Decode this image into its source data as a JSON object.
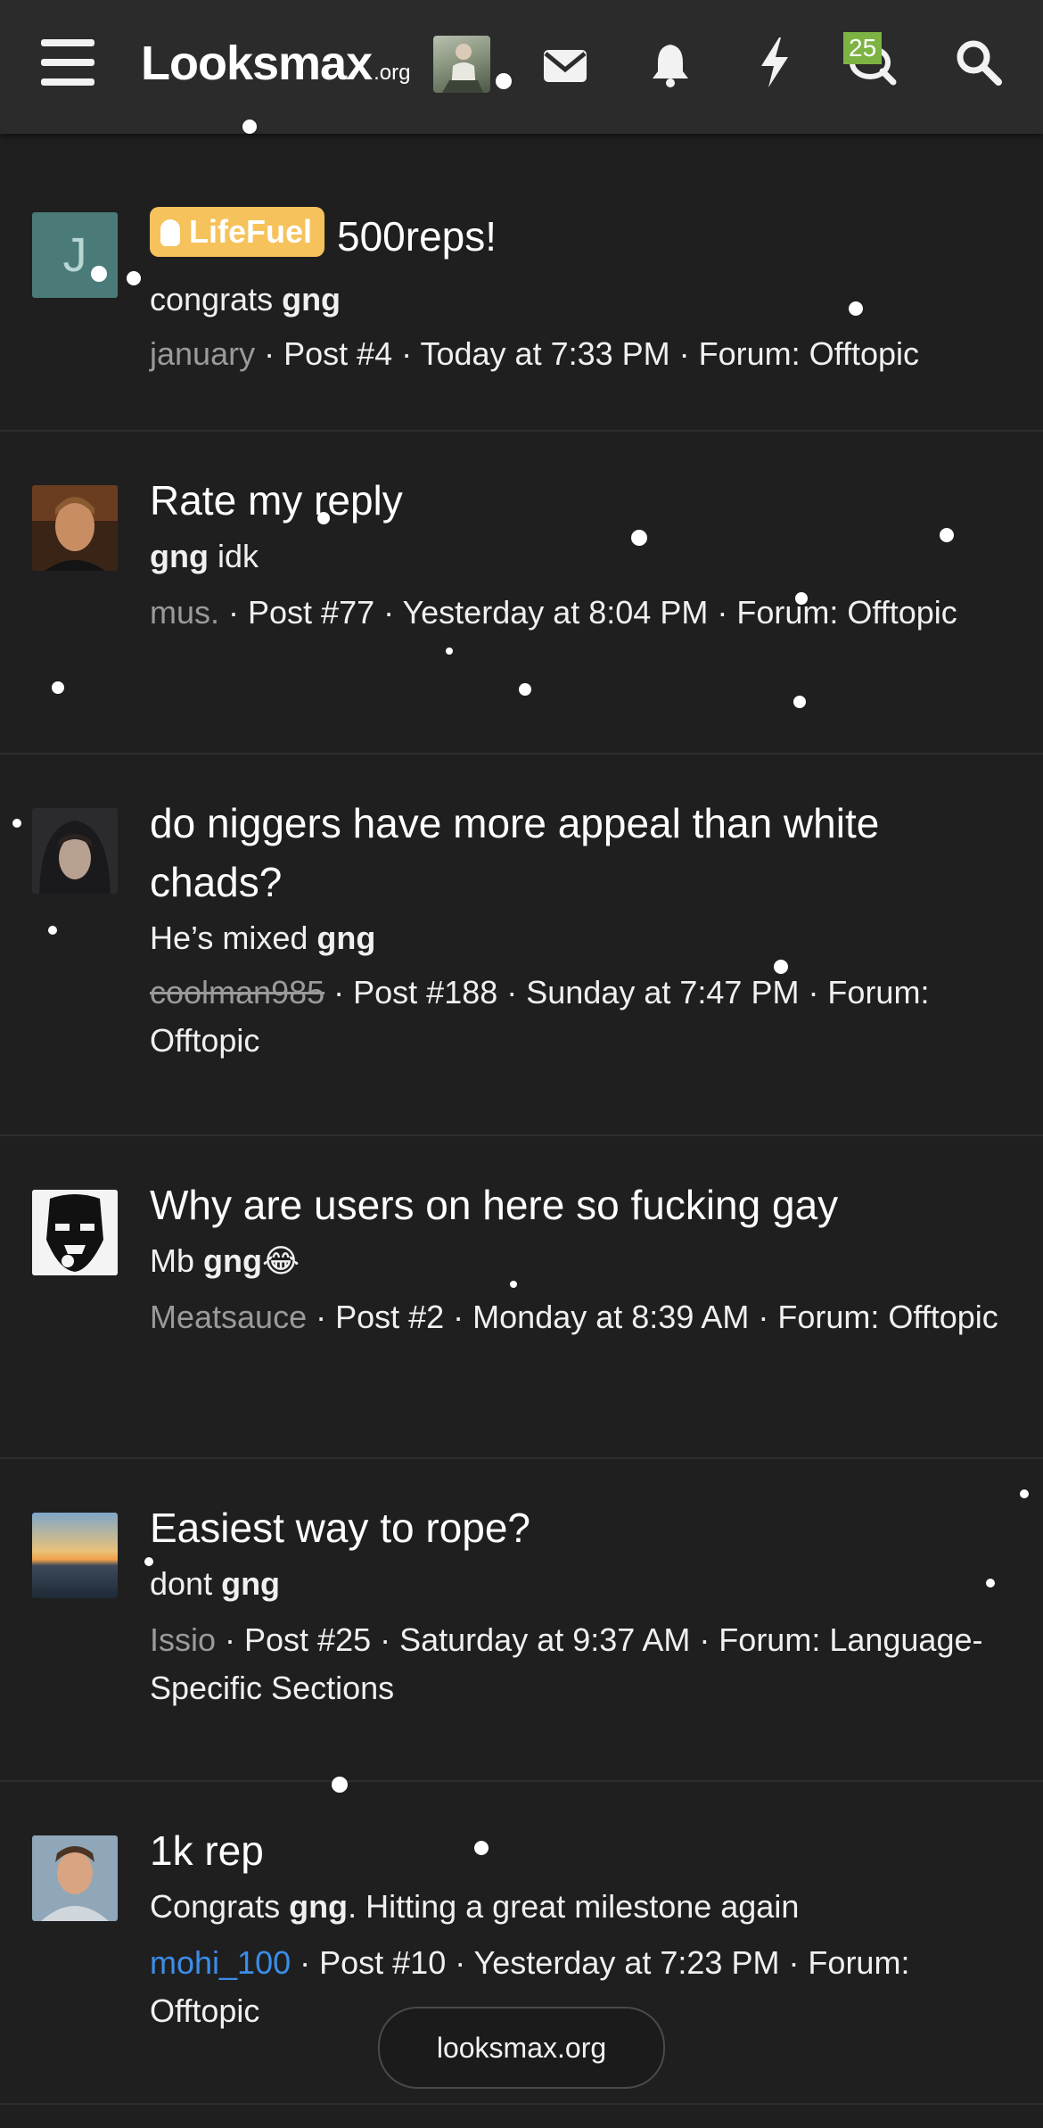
{
  "header": {
    "logo_main": "Looksmax",
    "logo_suffix": ".org",
    "chat_badge": "25",
    "icons": [
      "menu-icon",
      "envelope-icon",
      "bell-icon",
      "bolt-icon",
      "chat-icon",
      "search-icon"
    ]
  },
  "feed": [
    {
      "avatar_letter": "J",
      "prefix_label": "LifeFuel",
      "title": "500reps!",
      "snippet_pre": "congrats ",
      "snippet_bold": "gng",
      "snippet_post": "",
      "username": "january",
      "meta": " · Post #4 · Today at 7:33 PM · Forum: Offtopic"
    },
    {
      "title": "Rate my reply",
      "snippet_pre": "",
      "snippet_bold": "gng",
      "snippet_post": " idk",
      "username": "mus.",
      "meta": " · Post #77 · Yesterday at 8:04 PM · Forum: Offtopic"
    },
    {
      "title": "do niggers have more appeal than white chads?",
      "snippet_pre": "He’s mixed ",
      "snippet_bold": "gng",
      "snippet_post": "",
      "username": "coolman985",
      "meta": " · Post #188 · Sunday at 7:47 PM · Forum: Offtopic"
    },
    {
      "title": "Why are users on here so fucking gay",
      "snippet_pre": "Mb ",
      "snippet_bold": "gng",
      "snippet_post": "😂",
      "username": "Meatsauce",
      "meta": " · Post #2 · Monday at 8:39 AM · Forum: Offtopic"
    },
    {
      "title": "Easiest way to rope?",
      "snippet_pre": "dont ",
      "snippet_bold": "gng",
      "snippet_post": "",
      "username": "Issio",
      "meta": " · Post #25 · Saturday at 9:37 AM · Forum: Language-Specific Sections"
    },
    {
      "title": "1k rep",
      "snippet_pre": "Congrats ",
      "snippet_bold": "gng",
      "snippet_post": ". Hitting a great milestone again",
      "username": "mohi_100",
      "meta": " · Post #10 · Yesterday at 7:23 PM · Forum: Offtopic"
    }
  ],
  "footer_pill": "looksmax.org",
  "colors": {
    "background": "#1f1f20",
    "header": "#2b2b2c",
    "lifefuel_badge": "#f5c25c",
    "chat_badge": "#7cb342",
    "username_gray": "#9a9a9a",
    "username_blue": "#3c8de8"
  }
}
